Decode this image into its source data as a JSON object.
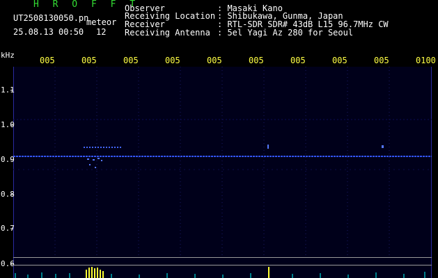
{
  "header": {
    "app_name": "H R O F F T",
    "filename": "UT2508130050.pn",
    "mode": "meteor",
    "datetime": "25.08.13 00:50",
    "count": "12"
  },
  "station": {
    "observer_label": "Observer",
    "observer_value": ": Masaki Kano",
    "location_label": "Receiving Location",
    "location_value": ": Shibukawa, Gunma, Japan",
    "receiver_label": "Receiver",
    "receiver_value": ": RTL-SDR SDR# 43dB L15 96.7MHz CW",
    "antenna_label": "Receiving Antenna",
    "antenna_value": ": 5el Yagi Az 280 for Seoul"
  },
  "axis": {
    "unit": "kHz",
    "y_ticks": [
      "1.1",
      "1.0",
      "0.9",
      "0.8",
      "0.7",
      "0.6"
    ],
    "time_ticks": [
      "005",
      "005",
      "005",
      "005",
      "005",
      "005",
      "005",
      "005",
      "005",
      "0100"
    ]
  },
  "colors": {
    "background": "#000000",
    "spectrogram": "#00001a",
    "signal_line": "#3355ff",
    "time_ticks": "#ffff44",
    "header_text": "#ffffff",
    "app_name": "#33dd33",
    "activity": "#00ffff"
  }
}
